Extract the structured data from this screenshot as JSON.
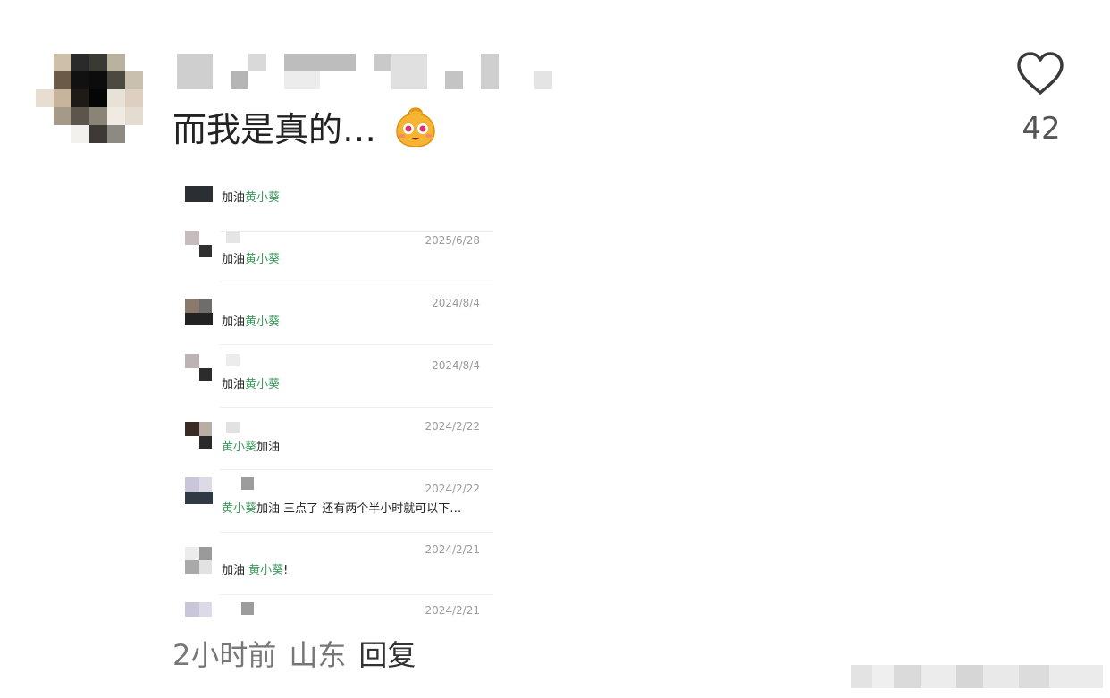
{
  "comment": {
    "text": "而我是真的…",
    "emoji": "smiling-face-emoji",
    "like_icon": "heart-outline-icon",
    "like_count": "42"
  },
  "screenshot_rows": [
    {
      "date": "",
      "parts": [
        "加油",
        "黄小葵",
        ""
      ]
    },
    {
      "date": "2025/6/28",
      "parts": [
        "加油",
        "黄小葵",
        ""
      ]
    },
    {
      "date": "2024/8/4",
      "parts": [
        "加油",
        "黄小葵",
        ""
      ]
    },
    {
      "date": "2024/8/4",
      "parts": [
        "加油",
        "黄小葵",
        ""
      ]
    },
    {
      "date": "2024/2/22",
      "parts": [
        "",
        "黄小葵",
        "加油"
      ]
    },
    {
      "date": "2024/2/22",
      "parts": [
        "",
        "黄小葵",
        "加油 三点了 还有两个半小时就可以下…"
      ]
    },
    {
      "date": "2024/2/21",
      "parts": [
        "加油 ",
        "黄小葵",
        "!"
      ]
    },
    {
      "date": "2024/2/21",
      "parts": [
        "",
        "",
        ""
      ]
    }
  ],
  "meta": {
    "time": "2小时前",
    "location": "山东",
    "reply": "回复"
  },
  "colors": {
    "highlight_green": "#3a9b5c",
    "meta_gray": "#777777"
  }
}
